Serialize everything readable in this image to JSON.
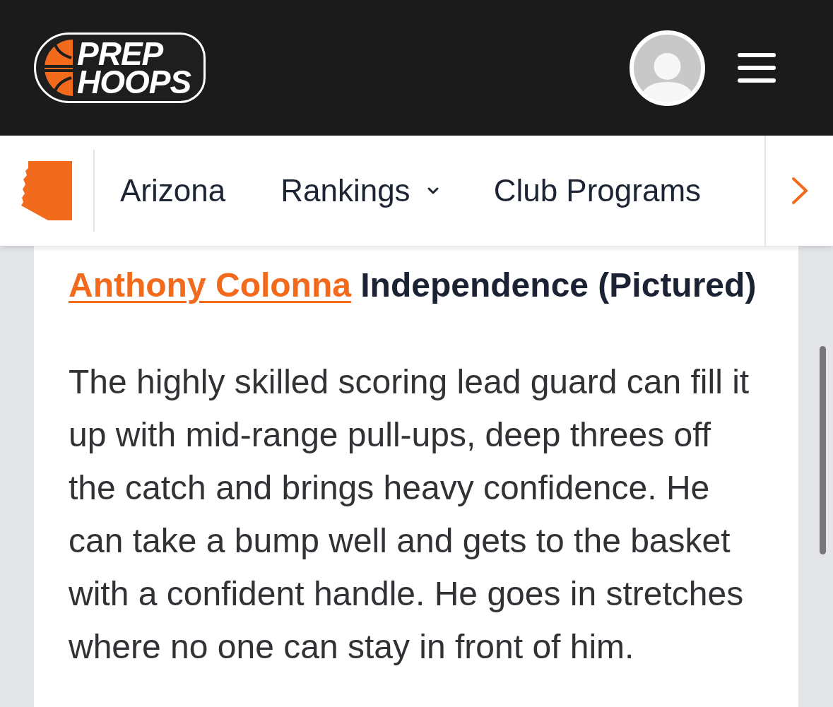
{
  "header": {
    "logo": {
      "line_1": "PREP",
      "line_2": "HOOPS"
    }
  },
  "nav": {
    "items": [
      {
        "kind": "link",
        "label": "Arizona"
      },
      {
        "kind": "dropdown",
        "label": "Rankings",
        "expanded": false
      },
      {
        "kind": "link",
        "label": "Club Programs"
      }
    ]
  },
  "article": {
    "heading": {
      "link": "Anthony Colonna",
      "text": "Independence (Pictured)"
    },
    "paragraph": "The highly skilled scoring lead guard can fill it up with mid-range pull-ups, deep threes off the catch and brings heavy confidence. He can take a bump well and gets to the basket with a confident handle. He goes in stretches where no one can stay in front of him."
  }
}
